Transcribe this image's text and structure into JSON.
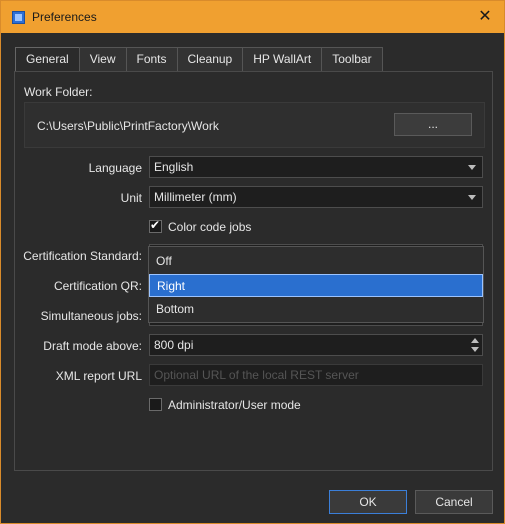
{
  "window": {
    "title": "Preferences"
  },
  "tabs": [
    {
      "label": "General"
    },
    {
      "label": "View"
    },
    {
      "label": "Fonts"
    },
    {
      "label": "Cleanup"
    },
    {
      "label": "HP WallArt"
    },
    {
      "label": "Toolbar"
    }
  ],
  "general": {
    "work_folder_label": "Work Folder:",
    "work_folder_path": "C:\\Users\\Public\\PrintFactory\\Work",
    "browse_label": "...",
    "language_label": "Language",
    "language_value": "English",
    "unit_label": "Unit",
    "unit_value": "Millimeter (mm)",
    "color_code_label": "Color code jobs",
    "color_code_checked": true,
    "cert_standard_label": "Certification Standard:",
    "cert_qr_label": "Certification QR:",
    "simultaneous_label": "Simultaneous jobs:",
    "draft_label": "Draft mode above:",
    "draft_value": "800 dpi",
    "xml_label": "XML report URL",
    "xml_placeholder": "Optional URL of the local REST server",
    "admin_label": "Administrator/User mode",
    "admin_checked": false
  },
  "dropdown": {
    "options": [
      "Off",
      "Right",
      "Bottom"
    ],
    "selected": "Right"
  },
  "buttons": {
    "ok": "OK",
    "cancel": "Cancel"
  },
  "colors": {
    "titlebar": "#f0a030",
    "selection": "#2a6fcf"
  }
}
